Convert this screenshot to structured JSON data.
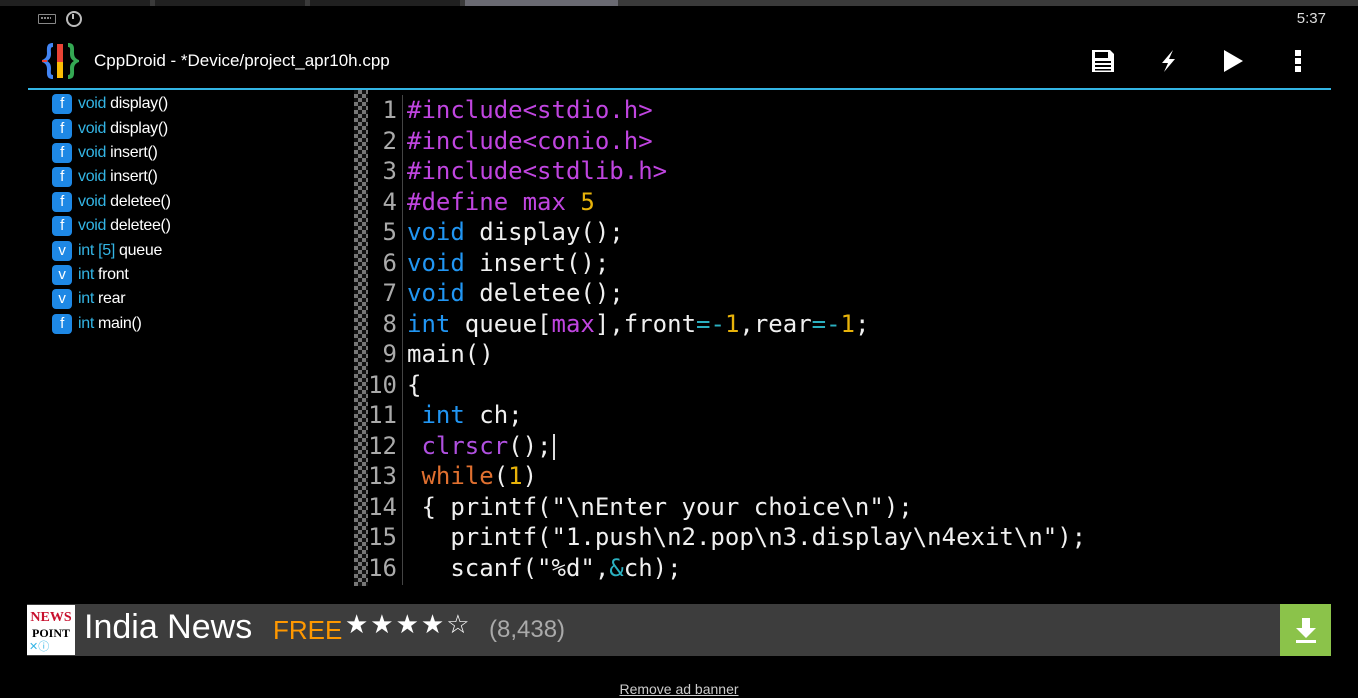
{
  "status_bar": {
    "time": "5:37",
    "icons": [
      "keyboard-icon",
      "timer-icon"
    ]
  },
  "action_bar": {
    "title": "CppDroid - *Device/project_apr10h.cpp",
    "actions": [
      "save-icon",
      "lightning-icon",
      "play-icon",
      "overflow-menu-icon"
    ],
    "accent_color": "#33b5e5"
  },
  "outline": {
    "items": [
      {
        "badge": "f",
        "type": "void",
        "name": "display()"
      },
      {
        "badge": "f",
        "type": "void",
        "name": "display()"
      },
      {
        "badge": "f",
        "type": "void",
        "name": "insert()"
      },
      {
        "badge": "f",
        "type": "void",
        "name": "insert()"
      },
      {
        "badge": "f",
        "type": "void",
        "name": "deletee()"
      },
      {
        "badge": "f",
        "type": "void",
        "name": "deletee()"
      },
      {
        "badge": "v",
        "type": "int [5]",
        "name": "queue"
      },
      {
        "badge": "v",
        "type": "int",
        "name": "front"
      },
      {
        "badge": "v",
        "type": "int",
        "name": "rear"
      },
      {
        "badge": "f",
        "type": "int",
        "name": "main()"
      }
    ]
  },
  "editor": {
    "lines": [
      {
        "n": "1",
        "tokens": [
          [
            "pp",
            "#include<stdio.h>"
          ]
        ]
      },
      {
        "n": "2",
        "tokens": [
          [
            "pp",
            "#include<conio.h>"
          ]
        ]
      },
      {
        "n": "3",
        "tokens": [
          [
            "pp",
            "#include<stdlib.h>"
          ]
        ]
      },
      {
        "n": "4",
        "tokens": [
          [
            "pp",
            "#define max "
          ],
          [
            "num",
            "5"
          ]
        ]
      },
      {
        "n": "5",
        "tokens": [
          [
            "kw",
            "void"
          ],
          [
            "id",
            " display();"
          ]
        ]
      },
      {
        "n": "6",
        "tokens": [
          [
            "kw",
            "void"
          ],
          [
            "id",
            " insert();"
          ]
        ]
      },
      {
        "n": "7",
        "tokens": [
          [
            "kw",
            "void"
          ],
          [
            "id",
            " deletee();"
          ]
        ]
      },
      {
        "n": "8",
        "tokens": [
          [
            "kw",
            "int"
          ],
          [
            "id",
            " queue["
          ],
          [
            "pp",
            "max"
          ],
          [
            "id",
            "],front"
          ],
          [
            "op",
            "=-"
          ],
          [
            "num",
            "1"
          ],
          [
            "id",
            ",rear"
          ],
          [
            "op",
            "=-"
          ],
          [
            "num",
            "1"
          ],
          [
            "id",
            ";"
          ]
        ]
      },
      {
        "n": "9",
        "tokens": [
          [
            "id",
            "main()"
          ]
        ]
      },
      {
        "n": "10",
        "tokens": [
          [
            "id",
            "{"
          ]
        ]
      },
      {
        "n": "11",
        "tokens": [
          [
            "id",
            " "
          ],
          [
            "kw",
            "int"
          ],
          [
            "id",
            " ch;"
          ]
        ]
      },
      {
        "n": "12",
        "tokens": [
          [
            "id",
            " "
          ],
          [
            "fn",
            "clrscr"
          ],
          [
            "id",
            "();"
          ]
        ],
        "caret": true
      },
      {
        "n": "13",
        "tokens": [
          [
            "id",
            " "
          ],
          [
            "ctrl",
            "while"
          ],
          [
            "id",
            "("
          ],
          [
            "num",
            "1"
          ],
          [
            "id",
            ")"
          ]
        ]
      },
      {
        "n": "14",
        "tokens": [
          [
            "id",
            " { printf(\"\\nEnter your choice\\n\");"
          ]
        ]
      },
      {
        "n": "15",
        "tokens": [
          [
            "id",
            "   printf(\"1.push\\n2.pop\\n3.display\\n4exit\\n\");"
          ]
        ]
      },
      {
        "n": "16",
        "tokens": [
          [
            "id",
            "   scanf(\"%d\","
          ],
          [
            "op",
            "&"
          ],
          [
            "id",
            "ch);"
          ]
        ]
      }
    ]
  },
  "ad": {
    "logo_line1": "NEWS",
    "logo_line2": "POINT",
    "logo_line3": "✕ⓘ",
    "title": "India News",
    "free": "FREE",
    "stars": "★★★★☆",
    "rating": 4,
    "count": "(8,438)",
    "download_icon": "download-icon",
    "remove_label": "Remove ad banner"
  }
}
